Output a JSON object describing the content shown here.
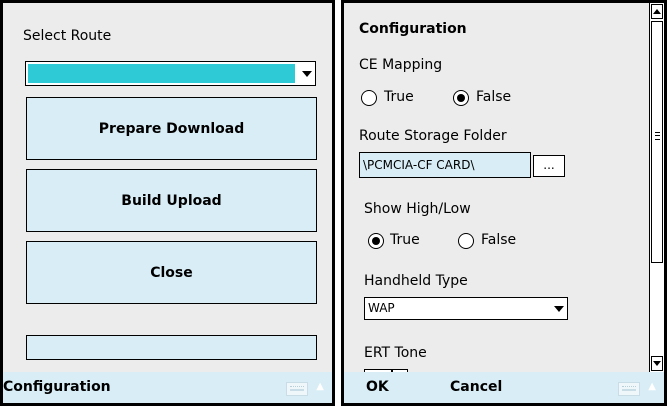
{
  "left_screen": {
    "select_route_label": "Select Route",
    "route_select": {
      "value": "",
      "fill_color": "#2ecbd6"
    },
    "buttons": [
      {
        "label": "Prepare Download"
      },
      {
        "label": "Build Upload"
      },
      {
        "label": "Close"
      }
    ],
    "status_field_value": "",
    "menubar": {
      "left_label": "Configuration"
    }
  },
  "right_screen": {
    "title": "Configuration",
    "ce_mapping": {
      "label": "CE Mapping",
      "options": [
        "True",
        "False"
      ],
      "selected": "False"
    },
    "route_storage_folder": {
      "label": "Route Storage Folder",
      "value": "\\PCMCIA-CF CARD\\",
      "browse_label": "..."
    },
    "show_high_low": {
      "label": "Show High/Low",
      "options": [
        "True",
        "False"
      ],
      "selected": "True"
    },
    "handheld_type": {
      "label": "Handheld Type",
      "value": "WAP"
    },
    "ert_tone": {
      "label": "ERT Tone"
    },
    "menubar": {
      "ok_label": "OK",
      "cancel_label": "Cancel"
    }
  },
  "colors": {
    "panel_bg": "#ececec",
    "menubar_bg": "#d8edf6",
    "button_bg": "#d8edf6",
    "accent": "#2ecbd6"
  },
  "icons": [
    "keyboard-icon",
    "chevron-up-icon",
    "dropdown-arrow-icon",
    "scroll-up-arrow-icon",
    "scroll-down-arrow-icon",
    "scroll-grip-icon"
  ]
}
